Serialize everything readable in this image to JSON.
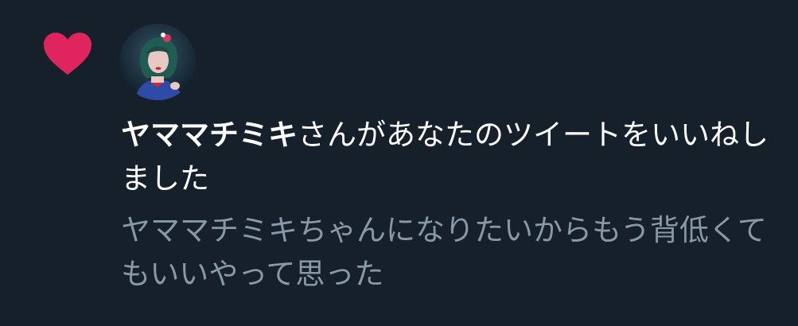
{
  "notification": {
    "type": "like",
    "icon": "heart-icon",
    "accent_color": "#e0245e",
    "user_name": "ヤママチミキ",
    "action_text": "さんがあなたのツイートをいいねしました",
    "tweet_text": "ヤママチミキちゃんになりたいからもう背低くてもいいやって思った"
  },
  "colors": {
    "background": "#15202b",
    "primary_text": "#ffffff",
    "secondary_text": "#8899a6"
  }
}
